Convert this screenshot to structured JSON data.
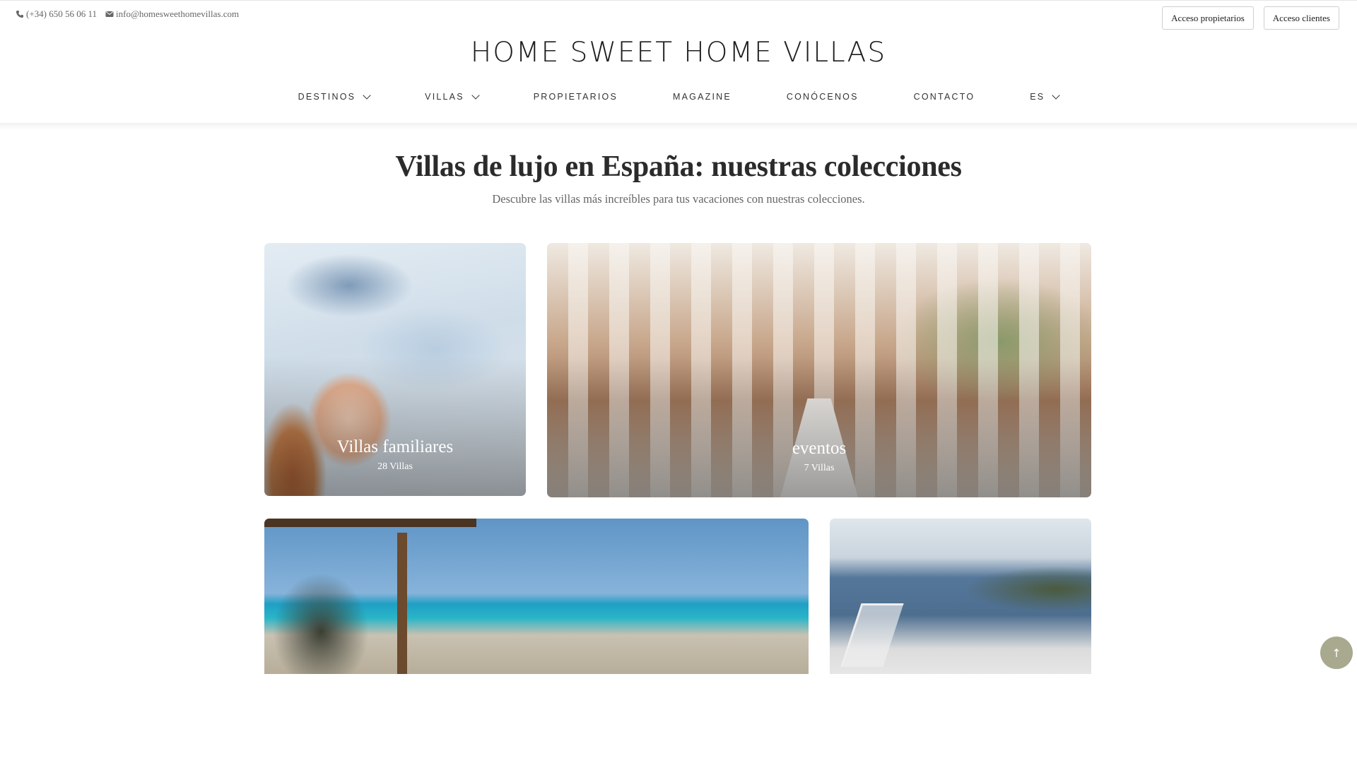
{
  "topbar": {
    "phone": "(+34) 650 56 06 11",
    "email": "info@homesweethomevillas.com",
    "owners_access": "Acceso propietarios",
    "clients_access": "Acceso clientes"
  },
  "logo": {
    "text": "HOME SWEET HOME VILLAS"
  },
  "nav": {
    "items": [
      {
        "label": "DESTINOS",
        "has_dropdown": true
      },
      {
        "label": "VILLAS",
        "has_dropdown": true
      },
      {
        "label": "PROPIETARIOS",
        "has_dropdown": false
      },
      {
        "label": "MAGAZINE",
        "has_dropdown": false
      },
      {
        "label": "CONÓCENOS",
        "has_dropdown": false
      },
      {
        "label": "CONTACTO",
        "has_dropdown": false
      },
      {
        "label": "ES",
        "has_dropdown": true
      }
    ]
  },
  "main": {
    "title": "Villas de lujo en España: nuestras colecciones",
    "subtitle": "Descubre las villas más increíbles para tus vacaciones con nuestras colecciones.",
    "collections": [
      {
        "name": "Villas familiares",
        "count": "28 Villas"
      },
      {
        "name": "eventos",
        "count": "7 Villas"
      },
      {
        "name": "",
        "count": ""
      },
      {
        "name": "",
        "count": ""
      }
    ]
  },
  "icons": {
    "phone": "phone-icon",
    "email": "envelope-icon",
    "dropdown": "chevron-down-icon",
    "scroll_top": "arrow-up-icon"
  },
  "colors": {
    "scroll_top_bg": "#a8a98f",
    "text": "#222222"
  }
}
